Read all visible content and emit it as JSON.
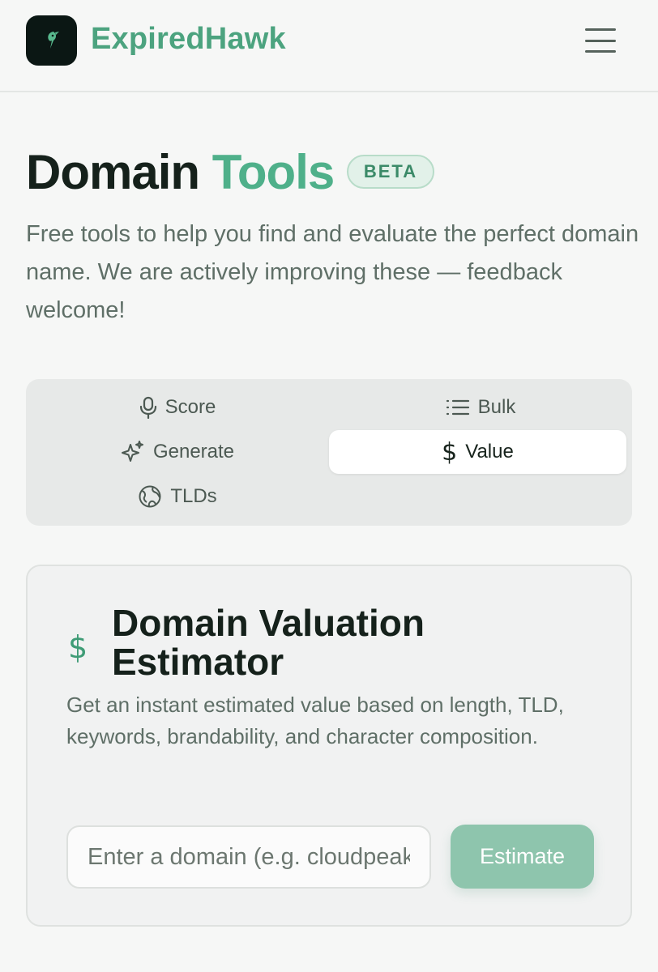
{
  "header": {
    "brand": "ExpiredHawk",
    "logo_icon": "hawk-icon",
    "menu_icon": "hamburger-menu-icon"
  },
  "hero": {
    "title_part1": "Domain",
    "title_part2": "Tools",
    "badge": "BETA",
    "subtitle": "Free tools to help you find and evaluate the perfect domain name. We are actively improving these — feedback welcome!"
  },
  "tabs": [
    {
      "label": "Score",
      "icon": "microphone-icon",
      "active": false
    },
    {
      "label": "Bulk",
      "icon": "list-icon",
      "active": false
    },
    {
      "label": "Generate",
      "icon": "sparkles-icon",
      "active": false
    },
    {
      "label": "Value",
      "icon": "dollar-icon",
      "active": true
    },
    {
      "label": "TLDs",
      "icon": "globe-icon",
      "active": false
    }
  ],
  "card": {
    "icon": "$",
    "title": "Domain Valuation Estimator",
    "description": "Get an instant estimated value based on length, TLD, keywords, brandability, and character composition.",
    "input_placeholder": "Enter a domain (e.g. cloudpeak.com)",
    "input_value": "",
    "button_label": "Estimate"
  },
  "colors": {
    "brand": "#4ca37f",
    "accent": "#4fb08a",
    "button": "#8ec5ad",
    "background": "#f6f7f6"
  }
}
